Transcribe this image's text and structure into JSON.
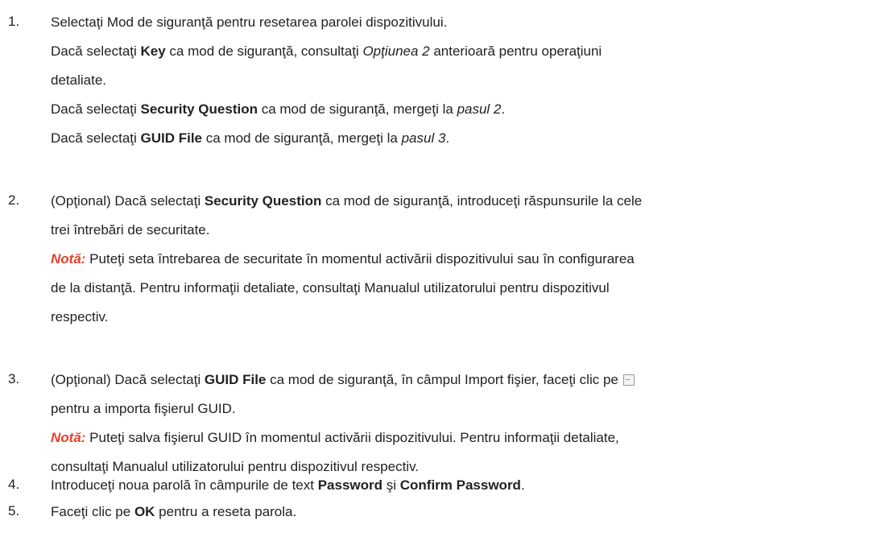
{
  "steps": [
    {
      "num": "1.",
      "lines": [
        {
          "parts": [
            {
              "t": "Selectaţi Mod de siguranţă pentru resetarea parolei dispozitivului."
            }
          ]
        },
        {
          "parts": [
            {
              "t": "Dacă selectaţi "
            },
            {
              "t": "Key",
              "s": "b"
            },
            {
              "t": " ca mod de siguranţă, consultaţi "
            },
            {
              "t": "Opţiunea 2",
              "s": "i"
            },
            {
              "t": " anterioară pentru operaţiuni"
            }
          ]
        },
        {
          "parts": [
            {
              "t": "detaliate."
            }
          ]
        },
        {
          "parts": [
            {
              "t": "Dacă selectaţi "
            },
            {
              "t": "Security Question",
              "s": "b"
            },
            {
              "t": " ca mod de siguranţă, mergeţi la "
            },
            {
              "t": "pasul 2",
              "s": "i"
            },
            {
              "t": "."
            }
          ]
        },
        {
          "parts": [
            {
              "t": "Dacă selectaţi "
            },
            {
              "t": "GUID File",
              "s": "b"
            },
            {
              "t": " ca mod de siguranţă, mergeţi la "
            },
            {
              "t": "pasul 3",
              "s": "i"
            },
            {
              "t": "."
            }
          ]
        }
      ]
    },
    {
      "num": "2.",
      "lines": [
        {
          "parts": [
            {
              "t": "(Opţional) Dacă selectaţi "
            },
            {
              "t": "Security Question",
              "s": "b"
            },
            {
              "t": " ca mod de siguranţă, introduceţi răspunsurile la cele"
            }
          ]
        },
        {
          "parts": [
            {
              "t": "trei întrebări de securitate."
            }
          ]
        },
        {
          "parts": [
            {
              "t": "Notă:",
              "s": "note"
            },
            {
              "t": " Puteţi seta întrebarea de securitate în momentul activării dispozitivului sau în configurarea"
            }
          ]
        },
        {
          "parts": [
            {
              "t": "de la distanţă. Pentru informaţii detaliate, consultaţi Manualul utilizatorului pentru dispozitivul"
            }
          ]
        },
        {
          "parts": [
            {
              "t": "respectiv."
            }
          ]
        }
      ]
    },
    {
      "num": "3.",
      "lines": [
        {
          "parts": [
            {
              "t": "(Opţional) Dacă selectaţi "
            },
            {
              "t": "GUID File",
              "s": "b"
            },
            {
              "t": " ca mod de siguranţă, în câmpul Import fişier, faceţi clic pe"
            },
            {
              "t": "",
              "s": "btn"
            }
          ]
        },
        {
          "parts": [
            {
              "t": "pentru a importa fişierul GUID."
            }
          ]
        },
        {
          "parts": [
            {
              "t": "Notă:",
              "s": "note"
            },
            {
              "t": " Puteţi salva fişierul GUID în momentul activării dispozitivului. Pentru informaţii detaliate,"
            }
          ]
        },
        {
          "parts": [
            {
              "t": "consultaţi Manualul utilizatorului pentru dispozitivul respectiv."
            }
          ]
        }
      ]
    },
    {
      "num": "4.",
      "lines": [
        {
          "parts": [
            {
              "t": "Introduceţi noua parolă în câmpurile de text "
            },
            {
              "t": "Password",
              "s": "b"
            },
            {
              "t": " şi "
            },
            {
              "t": "Confirm Password",
              "s": "b"
            },
            {
              "t": "."
            }
          ]
        }
      ]
    },
    {
      "num": "5.",
      "lines": [
        {
          "parts": [
            {
              "t": "Faceţi clic pe "
            },
            {
              "t": "OK",
              "s": "b"
            },
            {
              "t": " pentru a reseta parola."
            }
          ]
        }
      ]
    }
  ]
}
